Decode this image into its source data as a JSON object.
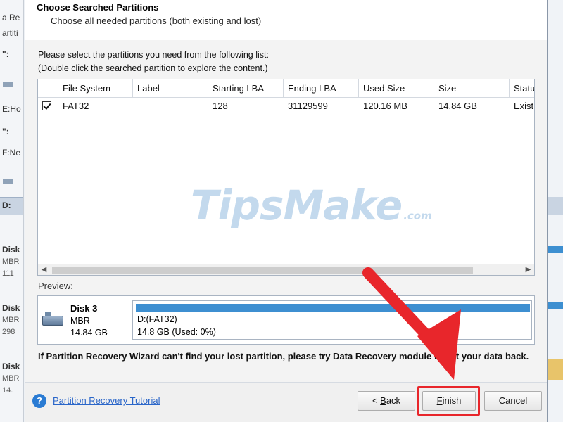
{
  "background": {
    "left_fragments": [
      "a Re",
      "artiti",
      "\":",
      "E:Ho",
      "\":",
      "F:Ne",
      "D:",
      "Disk",
      "MBR",
      "111",
      "Disk",
      "MBR",
      "298",
      "Disk",
      "MBR",
      "14."
    ]
  },
  "dialog": {
    "title": "Choose Searched Partitions",
    "subtitle": "Choose all needed partitions (both existing and lost)",
    "instruction_line1": "Please select the partitions you need from the following list:",
    "instruction_line2": "(Double click the searched partition to explore the content.)",
    "grid": {
      "columns": [
        "File System",
        "Label",
        "Starting LBA",
        "Ending LBA",
        "Used Size",
        "Size",
        "Statu"
      ],
      "rows": [
        {
          "checked": true,
          "file_system": "FAT32",
          "label": "",
          "starting_lba": "128",
          "ending_lba": "31129599",
          "used_size": "120.16 MB",
          "size": "14.84 GB",
          "status": "Exist"
        }
      ],
      "scroll_left": "◀",
      "scroll_right": "▶"
    },
    "watermark": {
      "text": "TipsMake",
      "domain": ".com"
    },
    "preview": {
      "label": "Preview:",
      "disk_name": "Disk 3",
      "disk_type": "MBR",
      "disk_size": "14.84 GB",
      "partition_name": "D:(FAT32)",
      "partition_usage": "14.8 GB (Used: 0%)",
      "used_fraction": 0.0
    },
    "note": "If Partition Recovery Wizard can't find your lost partition, please try Data Recovery module to get your data back."
  },
  "footer": {
    "help_icon": "?",
    "tutorial_link": "Partition Recovery Tutorial",
    "back_label": "< Back",
    "finish_label": "Finish",
    "cancel_label": "Cancel"
  },
  "colors": {
    "accent": "#3d8fd1",
    "link": "#2a66c9",
    "highlight": "#e8262b"
  }
}
